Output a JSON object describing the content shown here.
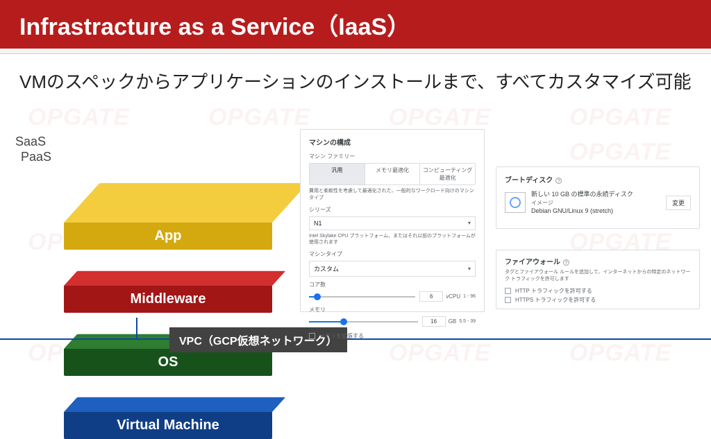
{
  "title": "Infrastracture as a Service（IaaS）",
  "subtitle": "VMのスペックからアプリケーションのインストールまで、すべてカスタマイズ可能",
  "labels": {
    "saas": "SaaS",
    "paas": "PaaS"
  },
  "stack": {
    "app": "App",
    "middleware": "Middleware",
    "os": "OS",
    "vm": "Virtual Machine",
    "vpc": "VPC（GCP仮想ネットワーク）"
  },
  "machine": {
    "heading": "マシンの構成",
    "family_label": "マシン ファミリー",
    "tabs": {
      "general": "汎用",
      "memory": "メモリ最適化",
      "compute": "コンピューティング最適化"
    },
    "family_hint": "費用と柔軟性を考慮して最適化された、一般的なワークロード向けのマシンタイプ",
    "series_label": "シリーズ",
    "series_value": "N1",
    "series_hint": "Intel Skylake CPU プラットフォーム、またはそれ以前のプラットフォームが使用されます",
    "type_label": "マシンタイプ",
    "type_value": "カスタム",
    "cores_label": "コア数",
    "cores_value": "6",
    "cores_unit": "vCPU",
    "cores_range": "1 - 96",
    "memory_label": "メモリ",
    "memory_value": "16",
    "memory_unit": "GB",
    "memory_range": "5.5 - 39",
    "extend_memory": "メモリを拡張する"
  },
  "disk": {
    "heading": "ブートディスク",
    "line1": "新しい 10 GB の標準の永続ディスク",
    "line2_label": "イメージ",
    "line2_value": "Debian GNU/Linux 9 (stretch)",
    "change": "変更"
  },
  "firewall": {
    "heading": "ファイアウォール",
    "hint": "タグとファイアウォール ルールを追加して、インターネットからの特定のネットワーク トラフィックを許可します",
    "http": "HTTP トラフィックを許可する",
    "https": "HTTPS トラフィックを許可する"
  },
  "watermark": "OPGATE"
}
